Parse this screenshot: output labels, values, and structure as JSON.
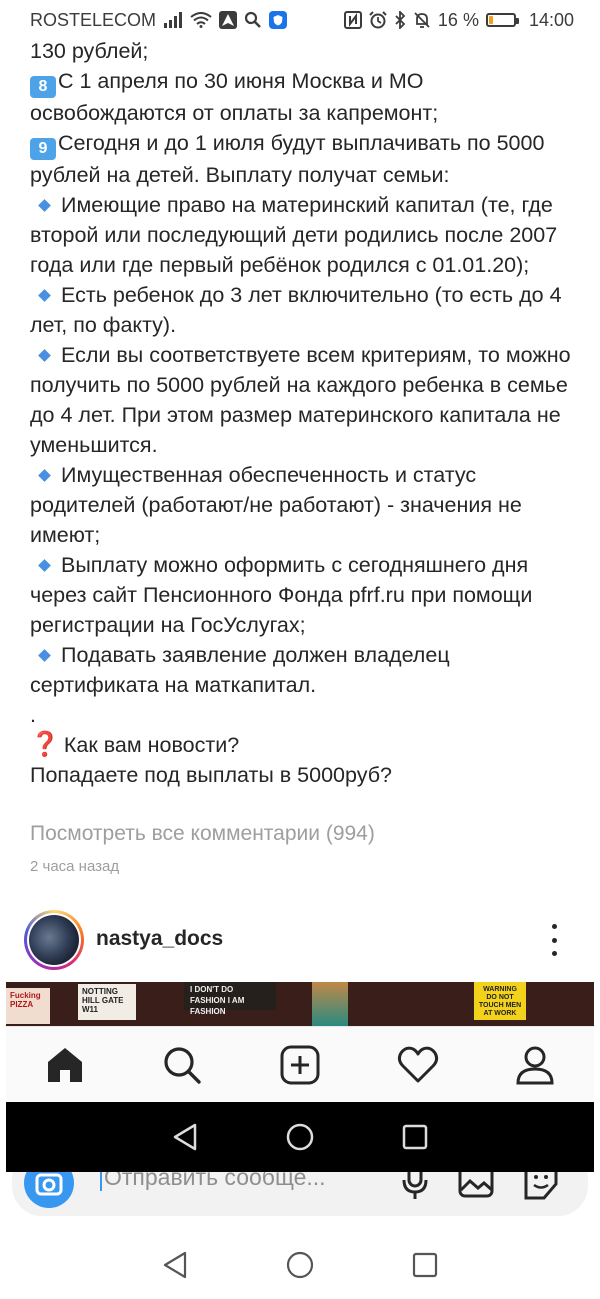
{
  "status_bar": {
    "carrier": "ROSTELECOM",
    "battery_percent": "16 %",
    "battery_level": 0.16,
    "time": "14:00"
  },
  "post": {
    "lines_intro": "130 рублей;",
    "item8_num": "8",
    "item8_text": "С 1 апреля по 30 июня Москва и МО освобождаются от оплаты за капремонт;",
    "item9_num": "9",
    "item9_text": "Сегодня и до 1 июля будут выплачивать по 5000 рублей на детей. Выплату получат семьи:",
    "bullets": [
      "Имеющие право на материнский капитал (те, где второй или последующий дети родились после 2007 года или где первый ребёнок родился с 01.01.20);",
      "Есть ребенок до 3 лет включительно (то есть до 4 лет, по факту).",
      "Если вы соответствуете всем критериям, то можно получить по 5000 рублей на каждого ребенка в семье до 4 лет. При этом размер материнского капитала не уменьшится.",
      "Имущественная обеспеченность и статус родителей (работают/не работают) - значения не имеют;",
      "Выплату можно оформить с сегодняшнего дня через сайт Пенсионного Фонда pfrf.ru при помощи регистрации на ГосУслугах;",
      "Подавать заявление должен владелец сертификата на маткапитал."
    ],
    "dot": ".",
    "question_icon": "❓",
    "question1": "Как вам новости?",
    "question2": "Попадаете под выплаты в 5000руб?"
  },
  "comments_link": "Посмотреть все комментарии (994)",
  "timestamp": "2 часа назад",
  "next_post": {
    "username": "nastya_docs"
  },
  "image_signs": {
    "sign1": "Fucking PIZZA",
    "sign2": "NOTTING HILL GATE W11",
    "sign3": "I DON'T DO FASHION I AM FASHION",
    "sign4": "WARNING DO NOT TOUCH MEN AT WORK"
  },
  "message_bar": {
    "placeholder": "Отправить сообще..."
  },
  "colors": {
    "accent_blue": "#3897f0",
    "number_icon_blue": "#4ea3e8",
    "bullet_blue": "#4a90e2",
    "muted_text": "#9e9e9e"
  }
}
